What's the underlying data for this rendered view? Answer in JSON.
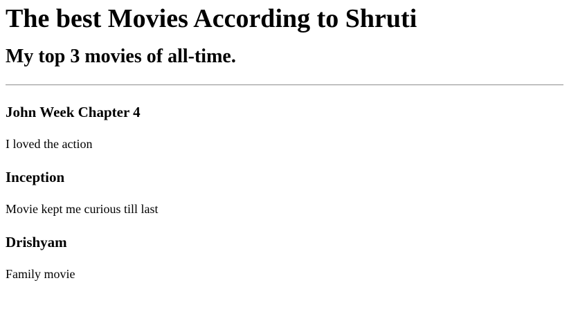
{
  "page": {
    "title": "The best Movies According to Shruti",
    "subtitle": "My top 3 movies of all-time."
  },
  "movies": [
    {
      "title": "John Week Chapter 4",
      "review": "I loved the action"
    },
    {
      "title": "Inception",
      "review": "Movie kept me curious till last"
    },
    {
      "title": "Drishyam",
      "review": "Family movie"
    }
  ]
}
